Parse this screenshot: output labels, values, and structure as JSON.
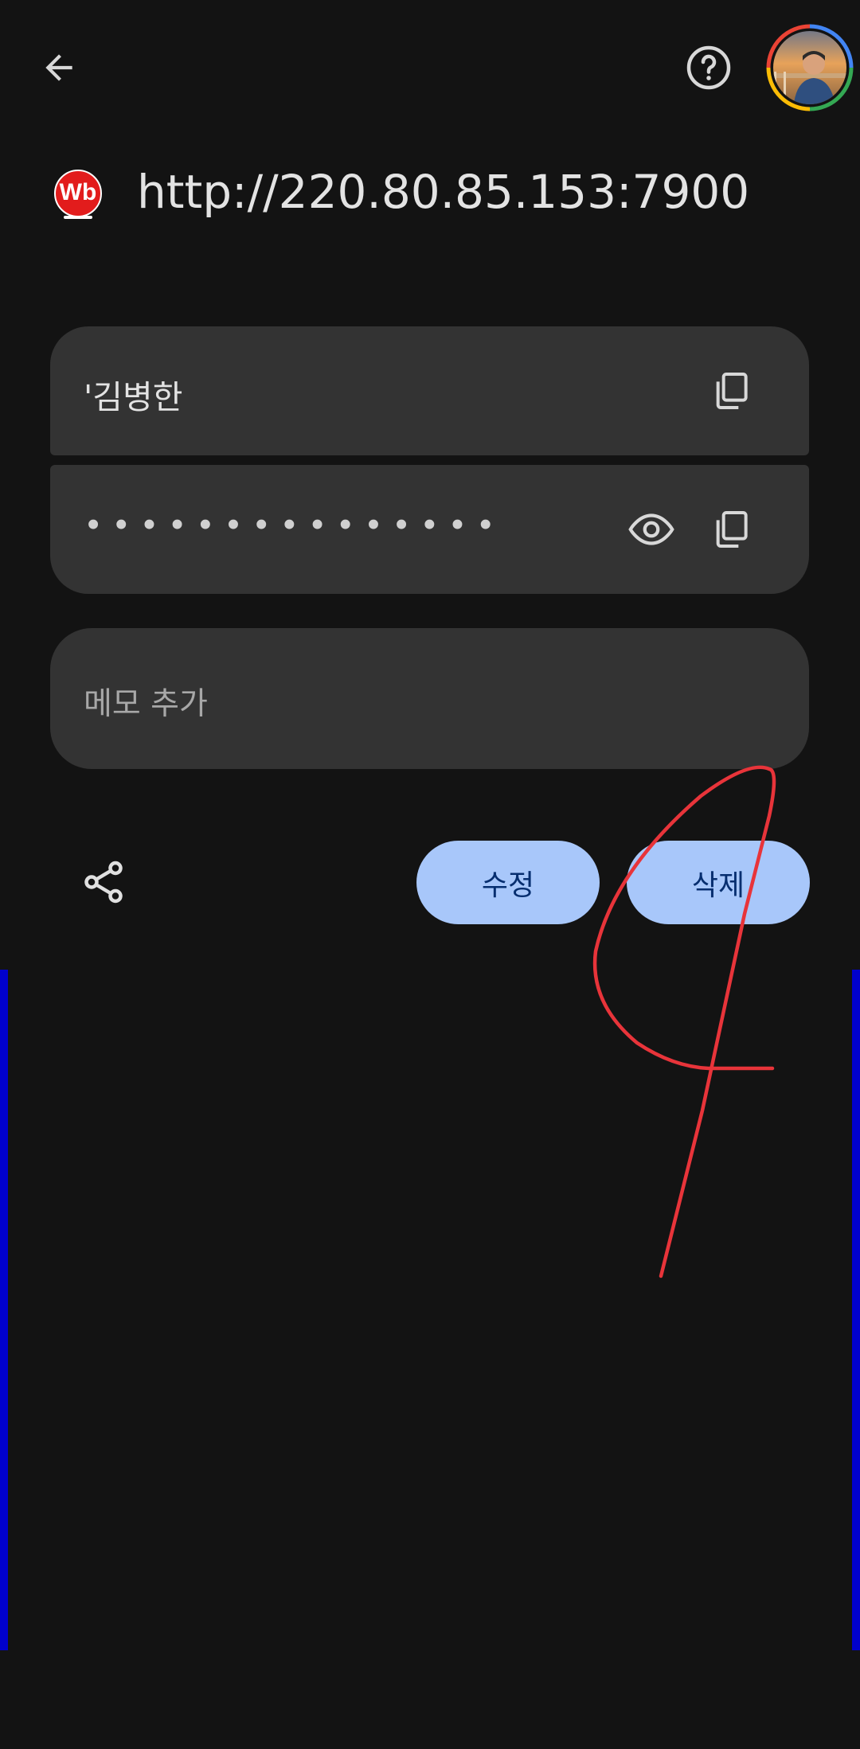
{
  "header": {
    "back_icon": "arrow-left-icon",
    "help_icon": "help-circle-icon",
    "avatar_label": "account-avatar"
  },
  "site": {
    "favicon_text": "Wb",
    "url": "http://220.80.85.153:7900"
  },
  "credentials": {
    "username": "'김병한",
    "password_mask": "•••••••••••••••",
    "copy_icon": "copy-icon",
    "visibility_icon": "eye-icon"
  },
  "note": {
    "placeholder": "메모 추가"
  },
  "actions": {
    "share_icon": "share-icon",
    "edit_label": "수정",
    "delete_label": "삭제"
  },
  "colors": {
    "background": "#131313",
    "card": "#333333",
    "button_bg": "#a8c7fa",
    "button_text": "#062e6f",
    "annotation": "#e8343a",
    "side_bar": "#0000cc"
  }
}
